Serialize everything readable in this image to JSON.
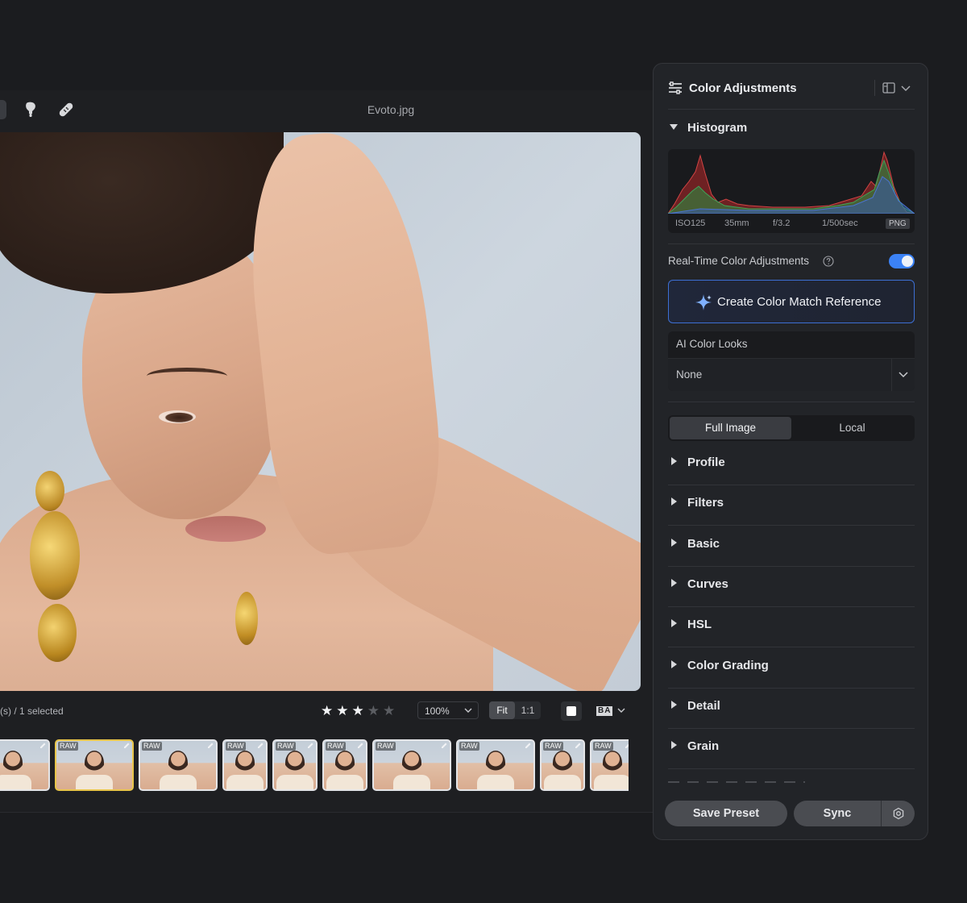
{
  "window": {
    "filename": "Evoto.jpg"
  },
  "toolbar": {
    "tools": [
      "retouch-brush-icon",
      "bandage-icon"
    ]
  },
  "statusbar": {
    "selection_text": "(s) / 1 selected",
    "rating": 3,
    "rating_max": 5,
    "zoom": "100%",
    "fit_label": "Fit",
    "one_to_one_label": "1:1",
    "before_after_label": "BA"
  },
  "filmstrip": {
    "thumbnails": [
      {
        "badge": ""
      },
      {
        "badge": "RAW"
      },
      {
        "badge": "RAW"
      },
      {
        "badge": "RAW"
      },
      {
        "badge": "RAW"
      },
      {
        "badge": "RAW"
      },
      {
        "badge": "RAW"
      },
      {
        "badge": "RAW"
      },
      {
        "badge": "RAW"
      },
      {
        "badge": "RAW"
      }
    ],
    "selected_index": 1
  },
  "panel": {
    "title": "Color Adjustments",
    "histogram": {
      "label": "Histogram",
      "iso": "ISO125",
      "focal": "35mm",
      "aperture": "f/3.2",
      "shutter": "1/500sec",
      "format": "PNG"
    },
    "realtime": {
      "label": "Real-Time Color Adjustments",
      "enabled": true
    },
    "match_button": "Create Color Match Reference",
    "ai_looks": {
      "label": "AI Color Looks",
      "value": "None"
    },
    "segments": {
      "full": "Full Image",
      "local": "Local",
      "active": "Full Image"
    },
    "sections": [
      "Profile",
      "Filters",
      "Basic",
      "Curves",
      "HSL",
      "Color Grading",
      "Detail",
      "Grain"
    ],
    "footer": {
      "save_preset": "Save Preset",
      "sync": "Sync"
    }
  },
  "colors": {
    "accent_blue": "#3b82f6",
    "selected_thumb": "#e8c54a",
    "panel_bg": "#222428",
    "app_bg": "#1b1c1f"
  }
}
